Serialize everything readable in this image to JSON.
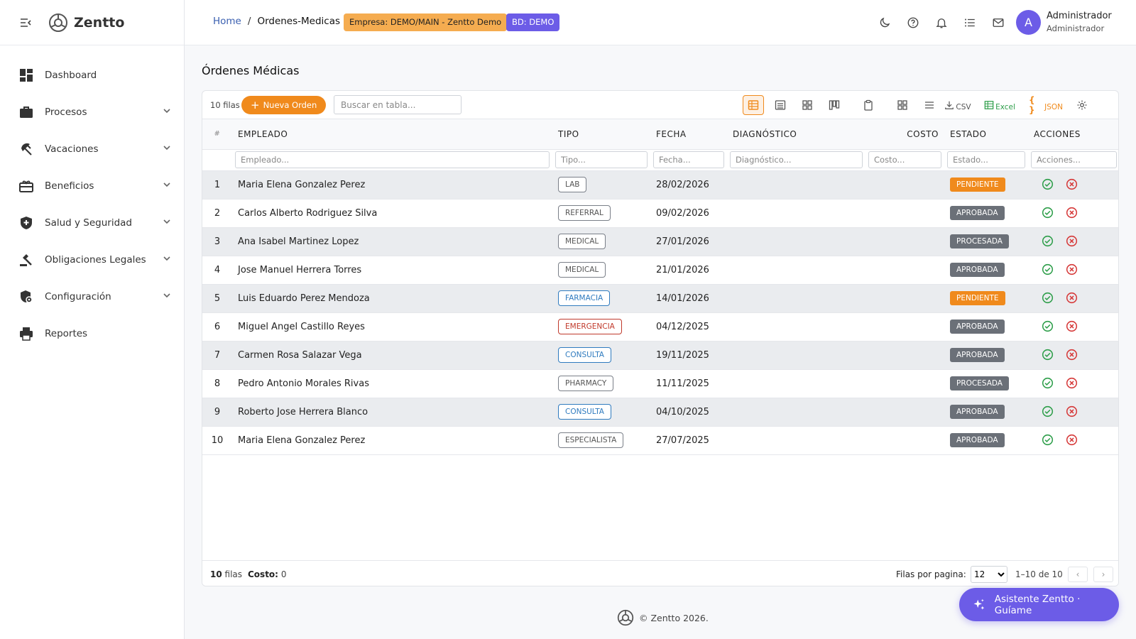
{
  "brand": {
    "name": "Zentto"
  },
  "sidebar": {
    "items": [
      {
        "label": "Dashboard",
        "icon": "dashboard-icon",
        "expandable": false
      },
      {
        "label": "Procesos",
        "icon": "briefcase-icon",
        "expandable": true
      },
      {
        "label": "Vacaciones",
        "icon": "beach-icon",
        "expandable": true
      },
      {
        "label": "Beneficios",
        "icon": "gift-card-icon",
        "expandable": true
      },
      {
        "label": "Salud y Seguridad",
        "icon": "health-shield-icon",
        "expandable": true
      },
      {
        "label": "Obligaciones Legales",
        "icon": "gavel-icon",
        "expandable": true
      },
      {
        "label": "Configuración",
        "icon": "settings-shield-icon",
        "expandable": true
      },
      {
        "label": "Reportes",
        "icon": "printer-icon",
        "expandable": false
      }
    ]
  },
  "header": {
    "breadcrumb": {
      "home": "Home",
      "sep": "/",
      "current": "Ordenes-Medicas"
    },
    "company_badge": "Empresa: DEMO/MAIN - Zentto Demo",
    "db_badge": "BD: DEMO",
    "icons": [
      "moon-icon",
      "help-icon",
      "bell-icon",
      "tasks-icon",
      "mail-icon"
    ],
    "user": {
      "initial": "A",
      "name": "Administrador",
      "role": "Administrador"
    }
  },
  "page": {
    "title": "Órdenes Médicas"
  },
  "toolbar": {
    "rows_label": "10 filas",
    "new_button": "Nueva Orden",
    "search_placeholder": "Buscar en tabla...",
    "csv_label": "CSV",
    "excel_label": "Excel",
    "json_label": "JSON"
  },
  "table": {
    "columns": [
      "#",
      "EMPLEADO",
      "TIPO",
      "FECHA",
      "DIAGNÓSTICO",
      "COSTO",
      "ESTADO",
      "ACCIONES"
    ],
    "filters": [
      "Empleado...",
      "Tipo...",
      "Fecha...",
      "Diagnóstico...",
      "Costo...",
      "Estado...",
      "Acciones..."
    ],
    "rows": [
      {
        "num": "1",
        "empleado": "Maria Elena Gonzalez Perez",
        "tipo": "LAB",
        "fecha": "28/02/2026",
        "diagnostico": "",
        "costo": "",
        "estado": "PENDIENTE"
      },
      {
        "num": "2",
        "empleado": "Carlos Alberto Rodriguez Silva",
        "tipo": "REFERRAL",
        "fecha": "09/02/2026",
        "diagnostico": "",
        "costo": "",
        "estado": "APROBADA"
      },
      {
        "num": "3",
        "empleado": "Ana Isabel Martinez Lopez",
        "tipo": "MEDICAL",
        "fecha": "27/01/2026",
        "diagnostico": "",
        "costo": "",
        "estado": "PROCESADA"
      },
      {
        "num": "4",
        "empleado": "Jose Manuel Herrera Torres",
        "tipo": "MEDICAL",
        "fecha": "21/01/2026",
        "diagnostico": "",
        "costo": "",
        "estado": "APROBADA"
      },
      {
        "num": "5",
        "empleado": "Luis Eduardo Perez Mendoza",
        "tipo": "FARMACIA",
        "fecha": "14/01/2026",
        "diagnostico": "",
        "costo": "",
        "estado": "PENDIENTE"
      },
      {
        "num": "6",
        "empleado": "Miguel Angel Castillo Reyes",
        "tipo": "EMERGENCIA",
        "fecha": "04/12/2025",
        "diagnostico": "",
        "costo": "",
        "estado": "APROBADA"
      },
      {
        "num": "7",
        "empleado": "Carmen Rosa Salazar Vega",
        "tipo": "CONSULTA",
        "fecha": "19/11/2025",
        "diagnostico": "",
        "costo": "",
        "estado": "APROBADA"
      },
      {
        "num": "8",
        "empleado": "Pedro Antonio Morales Rivas",
        "tipo": "PHARMACY",
        "fecha": "11/11/2025",
        "diagnostico": "",
        "costo": "",
        "estado": "PROCESADA"
      },
      {
        "num": "9",
        "empleado": "Roberto Jose Herrera Blanco",
        "tipo": "CONSULTA",
        "fecha": "04/10/2025",
        "diagnostico": "",
        "costo": "",
        "estado": "APROBADA"
      },
      {
        "num": "10",
        "empleado": "Maria Elena Gonzalez Perez",
        "tipo": "ESPECIALISTA",
        "fecha": "27/07/2025",
        "diagnostico": "",
        "costo": "",
        "estado": "APROBADA"
      }
    ]
  },
  "footer": {
    "rows_count": "10",
    "rows_word": "filas",
    "cost_label": "Costo:",
    "cost_value": "0",
    "per_page_label": "Filas por pagina:",
    "per_page_value": "12",
    "range": "1–10 de 10",
    "prev": "‹",
    "next": "›"
  },
  "copyright": "© Zentto 2026.",
  "assistant": {
    "label": "Asistente Zentto · Guíame"
  },
  "colors": {
    "accent": "#f08a1c",
    "purple": "#6c5ce7",
    "success": "#2e9e4a",
    "danger": "#d63a3a",
    "link": "#3a5fb0"
  }
}
